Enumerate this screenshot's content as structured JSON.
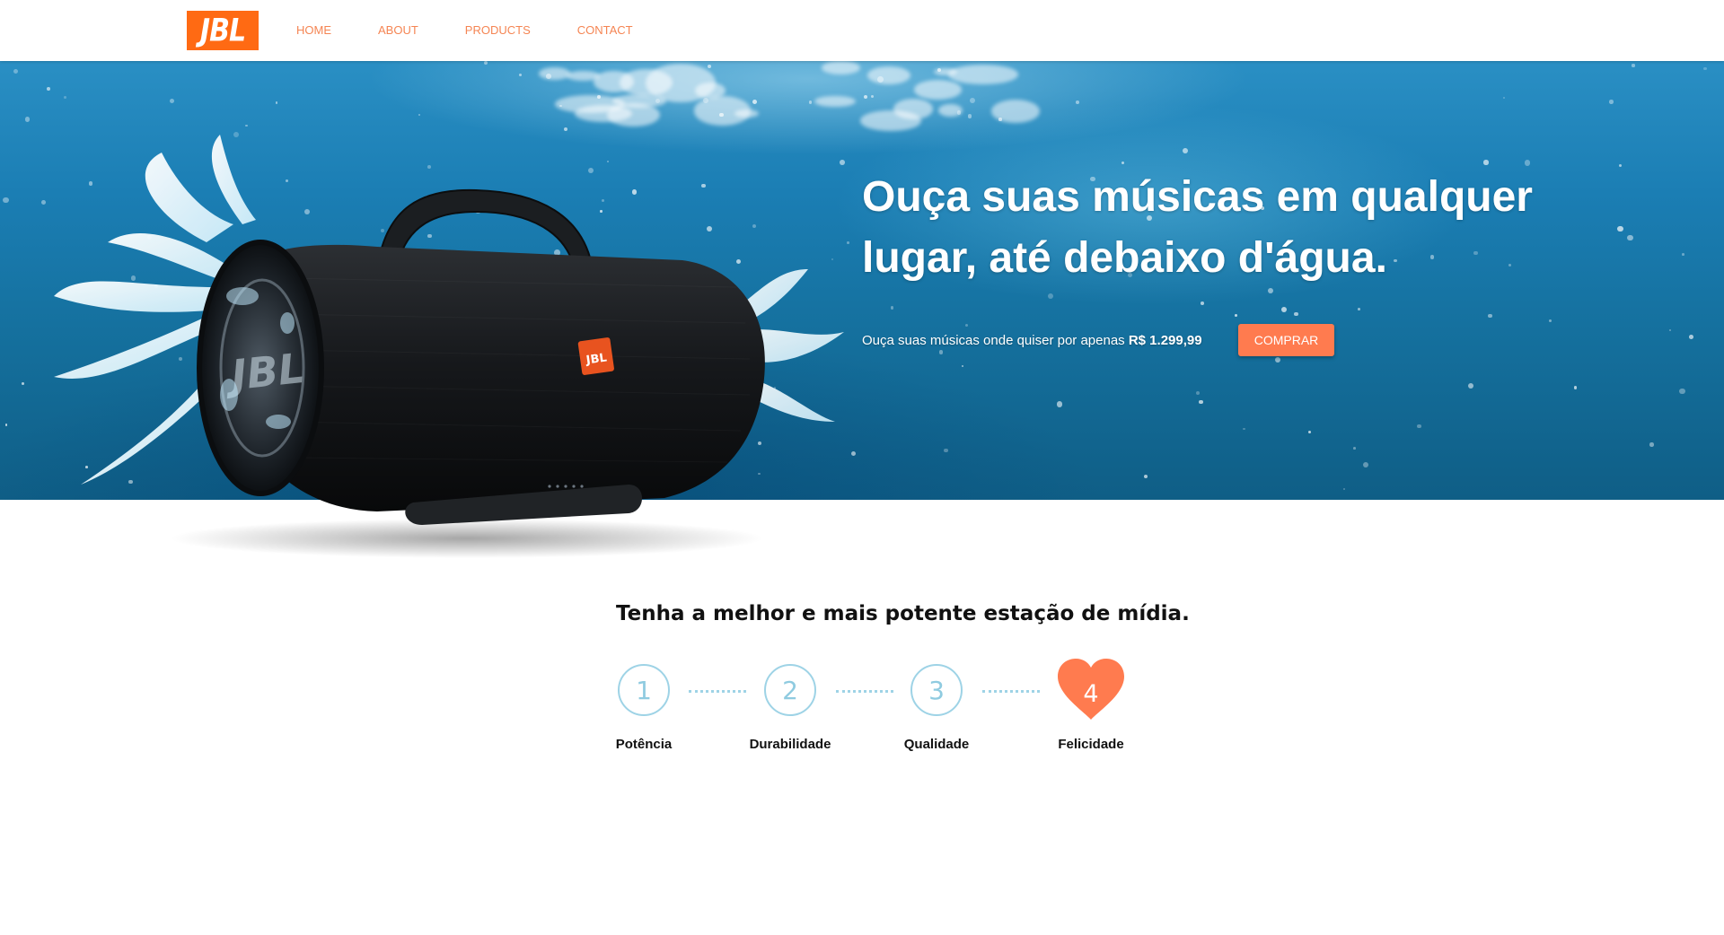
{
  "nav": {
    "logo_text": "JBL",
    "links": [
      {
        "label": "HOME"
      },
      {
        "label": "ABOUT"
      },
      {
        "label": "PRODUCTS"
      },
      {
        "label": "CONTACT"
      }
    ]
  },
  "hero": {
    "headline_line1": "Ouça suas músicas em qualquer",
    "headline_line2": "lugar, até debaixo d'água.",
    "subtitle": "Ouça suas músicas onde quiser por apenas",
    "price": "R$ 1.299,99",
    "button_label": "COMPRAR",
    "speaker_badge": "JBL"
  },
  "features": {
    "title": "Tenha a melhor e mais potente estação de mídia.",
    "steps": [
      {
        "number": "1",
        "label": "Potência"
      },
      {
        "number": "2",
        "label": "Durabilidade"
      },
      {
        "number": "3",
        "label": "Qualidade"
      },
      {
        "number": "4",
        "label": "Felicidade"
      }
    ]
  },
  "colors": {
    "brand_orange": "#ff6a13",
    "nav_link": "#f58553",
    "button": "#ff7b4f",
    "step_outline": "#9ed3e6",
    "heart": "#ff7b4f"
  }
}
